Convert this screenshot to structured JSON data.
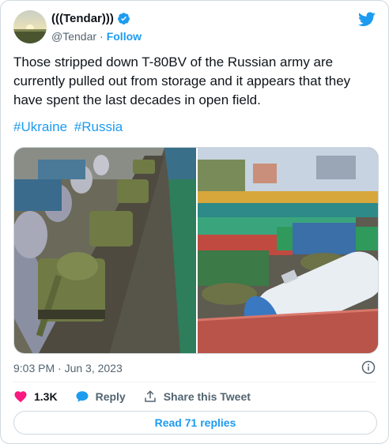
{
  "author": {
    "display_name": "(((Tendar)))",
    "handle": "@Tendar",
    "separator": "·",
    "follow_label": "Follow"
  },
  "tweet": {
    "text": "Those stripped down T-80BV of the Russian army are currently pulled out from storage and it appears that they have spent the last decades in open field.",
    "hashtags": [
      "#Ukraine",
      "#Russia"
    ],
    "timestamp": "9:03 PM · Jun 3, 2023"
  },
  "actions": {
    "like_count": "1.3K",
    "reply_label": "Reply",
    "share_label": "Share this Tweet"
  },
  "read_replies_label": "Read 71 replies",
  "icons": {
    "verified": "verified-badge-icon",
    "twitter": "twitter-bird-icon",
    "info": "info-icon",
    "like": "heart-icon",
    "reply": "reply-bubble-icon",
    "share": "share-upload-icon"
  },
  "colors": {
    "accent": "#1d9bf0",
    "like": "#f91880",
    "text": "#0f1419",
    "muted": "#536471"
  }
}
